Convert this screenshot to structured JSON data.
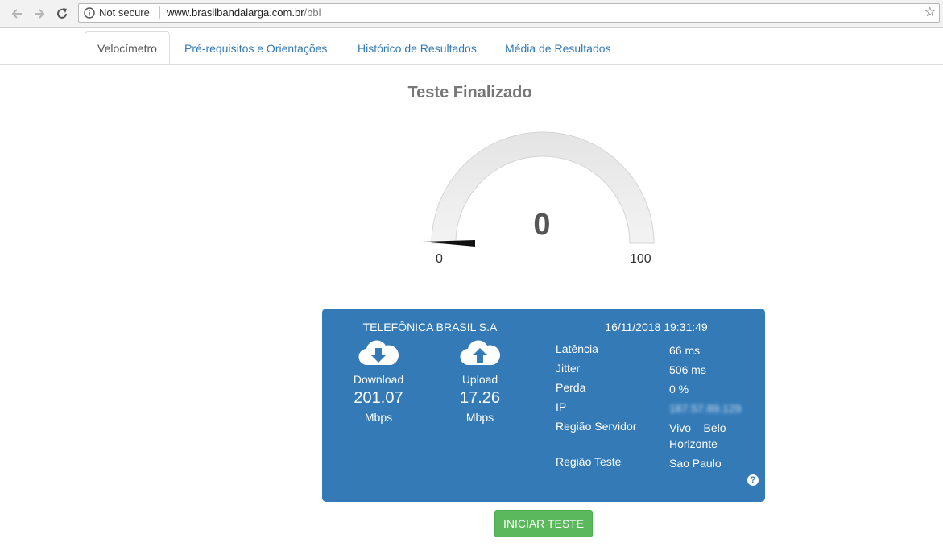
{
  "browser": {
    "security_label": "Not secure",
    "url_domain": "www.brasilbandalarga.com.br",
    "url_path": "/bbl"
  },
  "tabs": [
    {
      "label": "Velocímetro",
      "active": true
    },
    {
      "label": "Pré-requisitos e Orientações",
      "active": false
    },
    {
      "label": "Histórico de Resultados",
      "active": false
    },
    {
      "label": "Média de Resultados",
      "active": false
    }
  ],
  "status_title": "Teste Finalizado",
  "gauge": {
    "value": "0",
    "min_label": "0",
    "max_label": "100",
    "level_fraction": 0
  },
  "result": {
    "provider": "TELEFÔNICA BRASIL S.A",
    "timestamp": "16/11/2018 19:31:49",
    "download": {
      "label": "Download",
      "value": "201.07",
      "unit": "Mbps"
    },
    "upload": {
      "label": "Upload",
      "value": "17.26",
      "unit": "Mbps"
    },
    "details": [
      {
        "key": "Latência",
        "value": "66 ms"
      },
      {
        "key": "Jitter",
        "value": "506 ms"
      },
      {
        "key": "Perda",
        "value": "0 %"
      },
      {
        "key": "IP",
        "value": "187.57.89.129"
      },
      {
        "key": "Região Servidor",
        "value": "Vivo – Belo Horizonte"
      },
      {
        "key": "Região Teste",
        "value": "Sao Paulo"
      }
    ],
    "help_glyph": "?"
  },
  "start_button": "INICIAR TESTE",
  "colors": {
    "panel": "#337ab7",
    "button": "#5cb85c",
    "link": "#337ab7"
  }
}
